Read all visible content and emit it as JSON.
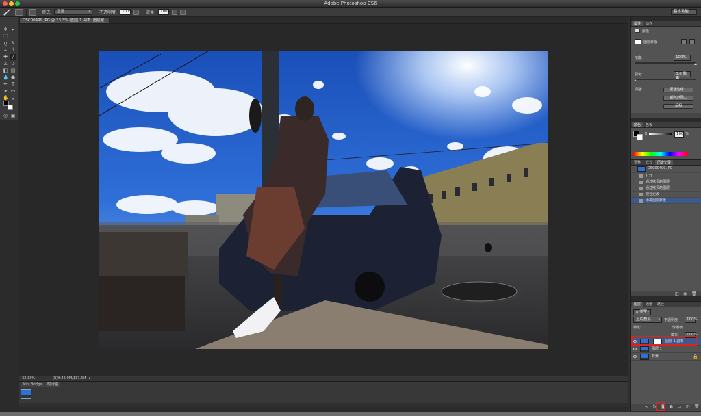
{
  "app_title": "Adobe Photoshop CS6",
  "options_bar": {
    "mode_label": "模式:",
    "mode_value": "正常",
    "opacity_label": "不透明度:",
    "opacity_value": "100%",
    "flow_label": "流量:",
    "flow_value": "100%",
    "workspace": "基本功能"
  },
  "document_tab": "DSC00499.JPG @ 33.3% (图层 1 副本, 图层蒙版/8) *",
  "status_bar": {
    "zoom": "33.33%",
    "doc_info": "文档:45.9M/137.6M"
  },
  "mini_bridge": {
    "tabs": [
      "Mini Bridge",
      "时间轴"
    ]
  },
  "properties_panel": {
    "tabs": [
      "属性",
      "动作"
    ],
    "header": "蒙版",
    "mask_label": "图层蒙版",
    "density_label": "浓度:",
    "density_value": "100%",
    "feather_label": "羽化:",
    "feather_value": "0.0 像素",
    "refine_label": "调整:",
    "buttons": [
      "蒙版边缘...",
      "颜色范围...",
      "反相"
    ]
  },
  "color_panel": {
    "tabs": [
      "颜色",
      "色板"
    ],
    "k_label": "K",
    "k_value": "100",
    "percent": "%"
  },
  "history_panel": {
    "tabs": [
      "调整",
      "样式",
      "历史记录"
    ],
    "snapshot": "DSC00499.JPG",
    "items": [
      "打开",
      "通过拷贝的图层",
      "通过拷贝的图层",
      "混合更改",
      "添加图层蒙版"
    ]
  },
  "layers_panel": {
    "tabs": [
      "图层",
      "通道",
      "路径"
    ],
    "kind_label": "ρ 类型",
    "blend_mode": "正片叠底",
    "opacity_label": "不透明度:",
    "opacity_value": "100%",
    "lock_label": "锁定:",
    "fill_label": "填充:",
    "fill_value": "100%",
    "propagate_label": "传播帧 1",
    "layers": [
      {
        "name": "图层 1 副本",
        "selected": true
      },
      {
        "name": "图层 1",
        "selected": false
      },
      {
        "name": "背景",
        "selected": false
      }
    ]
  },
  "colors": {
    "highlight": "#e0231f",
    "selected_row": "#3e5a8a",
    "panel_bg": "#535353"
  }
}
